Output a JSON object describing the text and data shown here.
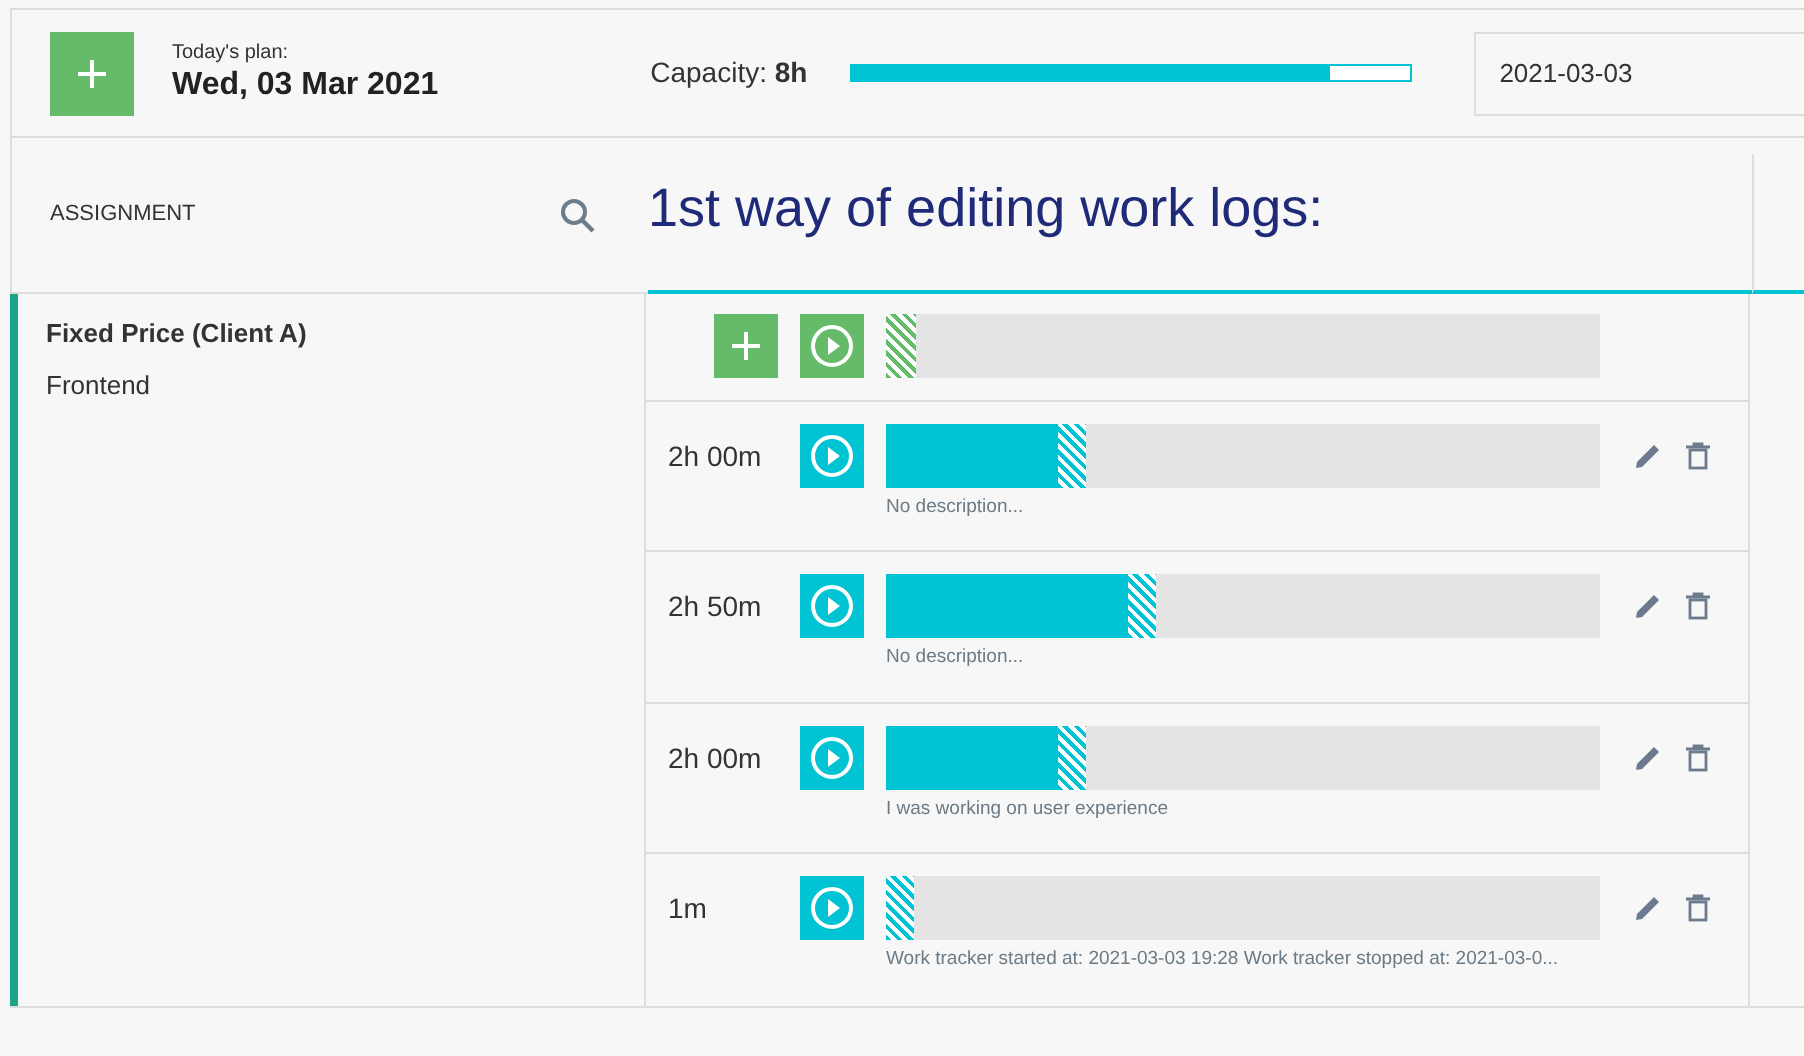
{
  "header": {
    "plan_label": "Today's plan:",
    "plan_date": "Wed, 03 Mar 2021",
    "capacity_label": "Capacity:",
    "capacity_value": "8h",
    "capacity_bar": {
      "level": 0.857
    },
    "date_value": "2021-03-03"
  },
  "assignment_header": "ASSIGNMENT",
  "title": "1st way of editing work logs:",
  "assignment": {
    "name": "Fixed Price (Client A)",
    "task": "Frontend"
  },
  "logs": [
    {
      "duration": "2h 00m",
      "level": 0.24,
      "description": "No description..."
    },
    {
      "duration": "2h 50m",
      "level": 0.34,
      "description": "No description..."
    },
    {
      "duration": "2h 00m",
      "level": 0.24,
      "description": "I was working on user experience"
    },
    {
      "duration": "1m",
      "level": 0,
      "description": "Work tracker started at: 2021-03-03 19:28 Work tracker stopped at: 2021-03-0..."
    }
  ]
}
